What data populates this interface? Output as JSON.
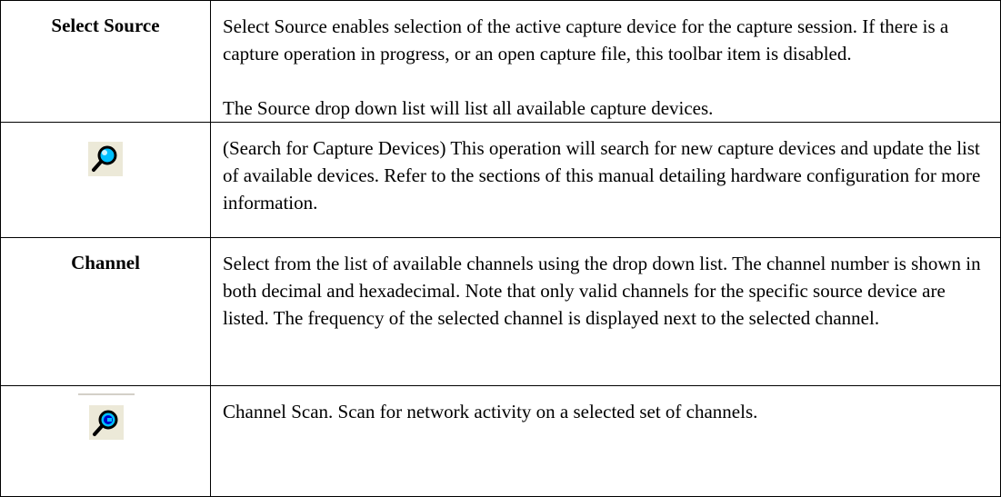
{
  "rows": [
    {
      "key": "Select Source",
      "description": [
        "Select Source enables selection of the active capture device for the capture session. If there is a capture operation in progress, or an open capture file, this toolbar item is disabled.",
        "The Source drop down list will list all available capture devices."
      ]
    },
    {
      "icon": "search-devices-icon",
      "description": [
        "(Search for Capture Devices)  This operation will search for new capture devices and update the list of available devices.  Refer to the sections of this manual detailing hardware configuration for more information."
      ]
    },
    {
      "key": "Channel",
      "description": [
        "Select from the list of available channels using the drop down list. The channel number is shown in both decimal and hexadecimal. Note that only valid channels for the specific source device are listed. The frequency of the selected channel is displayed next to the selected channel."
      ]
    },
    {
      "icon": "channel-scan-icon",
      "description": [
        "Channel Scan. Scan for network activity on a selected set of channels."
      ]
    }
  ],
  "colors": {
    "border": "#000000",
    "icon_background": "#ece9d8",
    "icon_lens": "#00c0ff",
    "icon_badge": "#0000cc"
  }
}
